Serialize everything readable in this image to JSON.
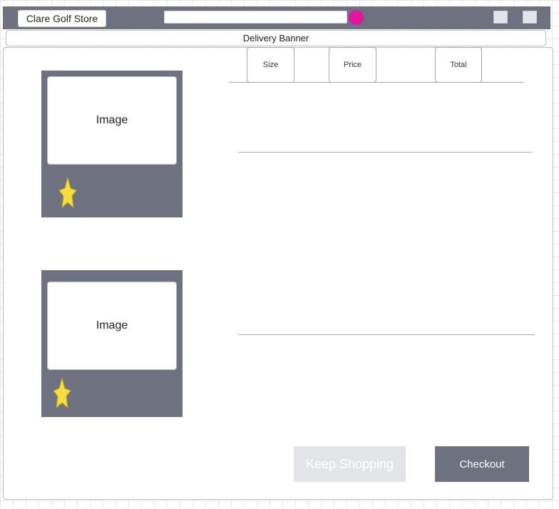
{
  "header": {
    "store_button_label": "Clare Golf Store",
    "search": {
      "value": "",
      "placeholder": ""
    },
    "accent_color": "#e0169e",
    "bar_color": "#6e7280"
  },
  "banner": {
    "label": "Delivery Banner"
  },
  "cart": {
    "columns": [
      "Size",
      "Price",
      "Total"
    ],
    "items": [
      {
        "image_label": "Image",
        "favorite_icon": "star-icon"
      },
      {
        "image_label": "Image",
        "favorite_icon": "star-icon"
      }
    ]
  },
  "actions": {
    "keep_shopping_label": "Keep Shopping",
    "checkout_label": "Checkout"
  },
  "colors": {
    "star": "#f6dc3c",
    "checkout": "#6e7280",
    "keep_shopping": "#e2e4e8"
  }
}
